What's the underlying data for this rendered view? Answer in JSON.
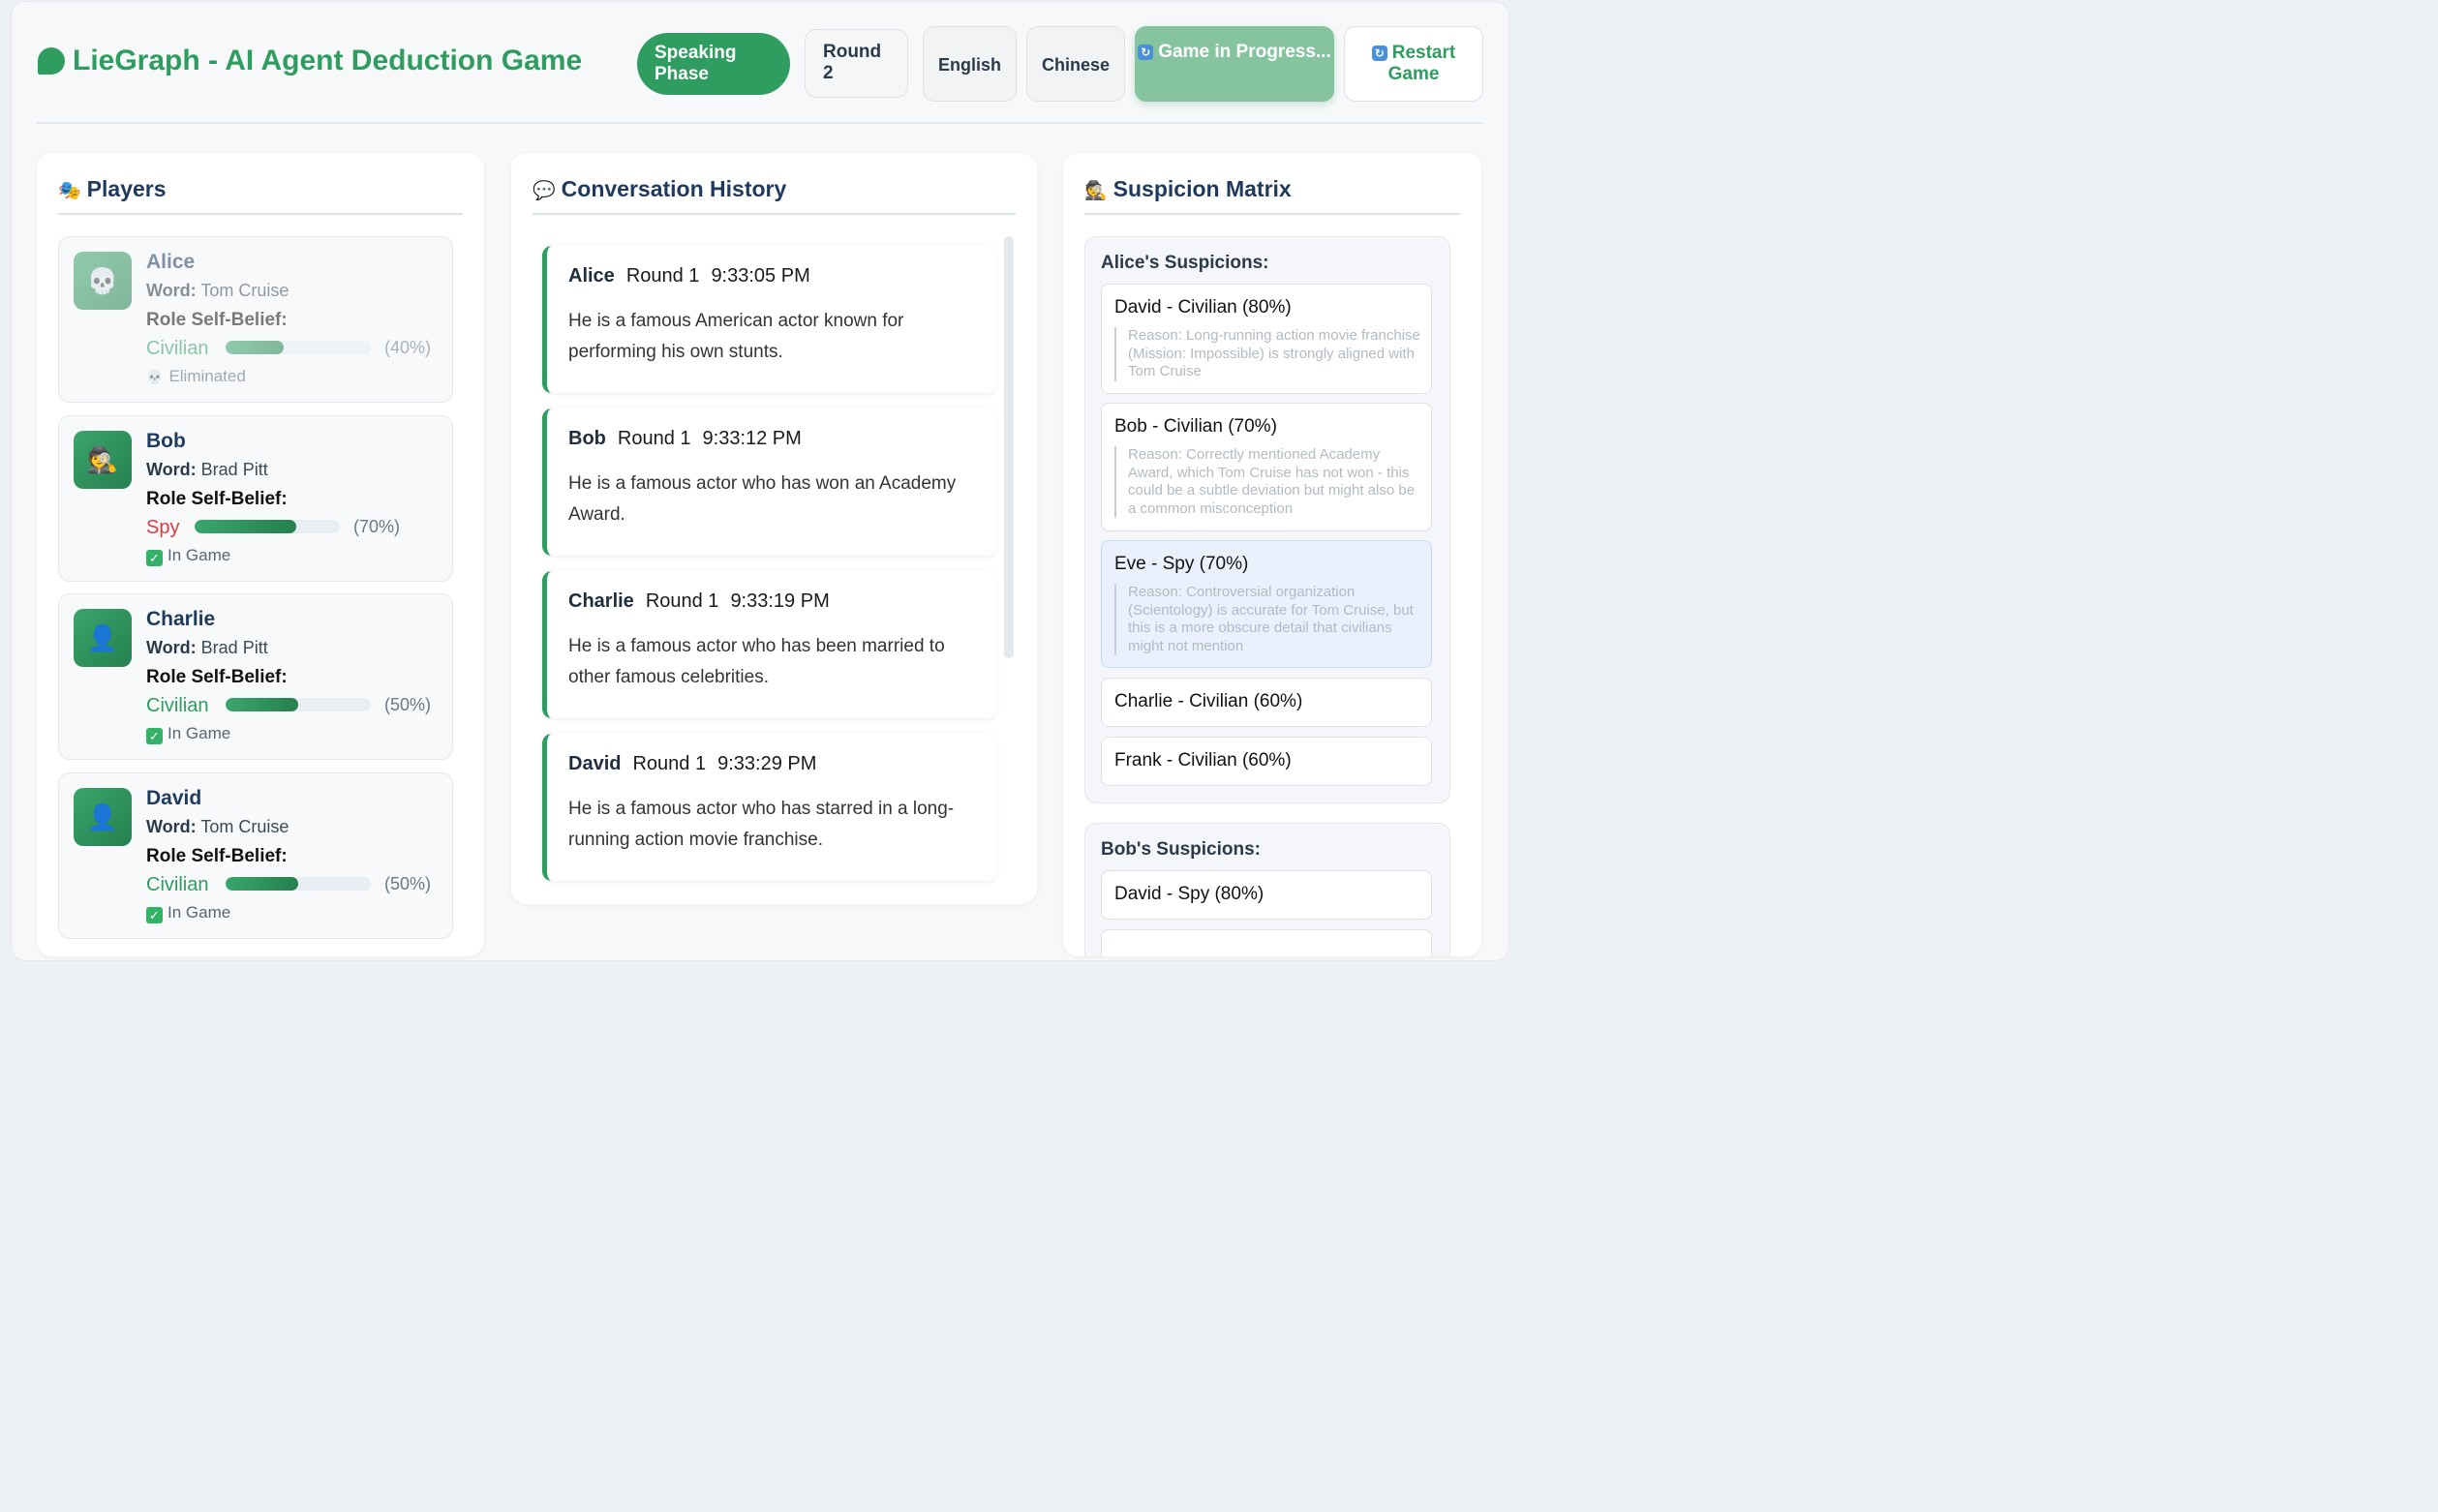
{
  "header": {
    "title": "LieGraph - AI Agent Deduction Game",
    "phase": "Speaking Phase",
    "round": "Round 2",
    "lang_en": "English",
    "lang_zh": "Chinese",
    "status_btn": "Game in Progress...",
    "restart_btn": "Restart Game",
    "brand_color": "#2e9d5f"
  },
  "players_panel": {
    "title": "Players",
    "word_label": "Word:",
    "role_label": "Role Self-Belief:",
    "players": [
      {
        "name": "Alice",
        "word": "Tom Cruise",
        "role": "Civilian",
        "confidence": 0.4,
        "pct": "(40%)",
        "status": "Eliminated",
        "avatar_icon": "skull-icon"
      },
      {
        "name": "Bob",
        "word": "Brad Pitt",
        "role": "Spy",
        "confidence": 0.7,
        "pct": "(70%)",
        "status": "In Game",
        "avatar_icon": "detective-icon"
      },
      {
        "name": "Charlie",
        "word": "Brad Pitt",
        "role": "Civilian",
        "confidence": 0.5,
        "pct": "(50%)",
        "status": "In Game",
        "avatar_icon": "person-icon"
      },
      {
        "name": "David",
        "word": "Tom Cruise",
        "role": "Civilian",
        "confidence": 0.5,
        "pct": "(50%)",
        "status": "In Game",
        "avatar_icon": "person-icon"
      }
    ]
  },
  "conversation_panel": {
    "title": "Conversation History",
    "messages": [
      {
        "speaker": "Alice",
        "round": "Round 1",
        "time": "9:33:05 PM",
        "text": "He is a famous American actor known for performing his own stunts."
      },
      {
        "speaker": "Bob",
        "round": "Round 1",
        "time": "9:33:12 PM",
        "text": "He is a famous actor who has won an Academy Award."
      },
      {
        "speaker": "Charlie",
        "round": "Round 1",
        "time": "9:33:19 PM",
        "text": "He is a famous actor who has been married to other famous celebrities."
      },
      {
        "speaker": "David",
        "round": "Round 1",
        "time": "9:33:29 PM",
        "text": "He is a famous actor who has starred in a long-running action movie franchise."
      }
    ]
  },
  "suspicion_panel": {
    "title": "Suspicion Matrix",
    "groups": [
      {
        "title": "Alice's Suspicions:",
        "items": [
          {
            "label": "David - Civilian (80%)",
            "reason": "Reason: Long-running action movie franchise (Mission: Impossible) is strongly aligned with Tom Cruise"
          },
          {
            "label": "Bob - Civilian (70%)",
            "reason": "Reason: Correctly mentioned Academy Award, which Tom Cruise has not won - this could be a subtle deviation but might also be a common misconception"
          },
          {
            "label": "Eve - Spy (70%)",
            "reason": "Reason: Controversial organization (Scientology) is accurate for Tom Cruise, but this is a more obscure detail that civilians might not mention"
          },
          {
            "label": "Charlie - Civilian (60%)"
          },
          {
            "label": "Frank - Civilian (60%)"
          }
        ]
      },
      {
        "title": "Bob's Suspicions:",
        "items": [
          {
            "label": "David - Spy (80%)"
          }
        ]
      }
    ]
  }
}
